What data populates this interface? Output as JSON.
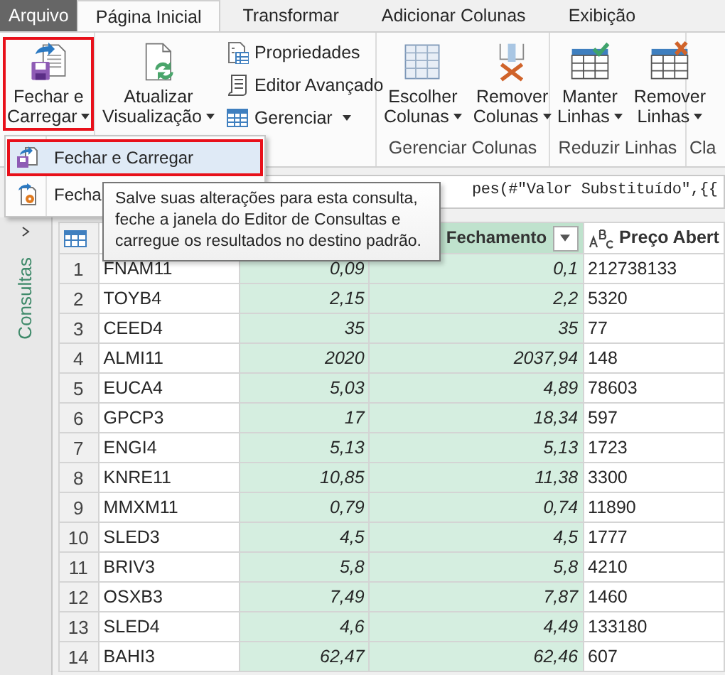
{
  "tabs": [
    {
      "label": "Arquivo",
      "kind": "file",
      "selected": false
    },
    {
      "label": "Página Inicial",
      "kind": "tab",
      "selected": true
    },
    {
      "label": "Transformar",
      "kind": "tab",
      "selected": false
    },
    {
      "label": "Adicionar Colunas",
      "kind": "tab",
      "selected": false
    },
    {
      "label": "Exibição",
      "kind": "tab",
      "selected": false
    }
  ],
  "ribbon": {
    "groups": [
      {
        "buttons": [
          {
            "kind": "large",
            "lines": [
              "Fechar e",
              "Carregar"
            ],
            "dropdown": true,
            "outlined": true
          }
        ]
      },
      {
        "buttons": [
          {
            "kind": "large",
            "lines": [
              "Atualizar",
              "Visualização"
            ],
            "dropdown": true,
            "outlined": false
          },
          {
            "kind": "small",
            "lines": [
              "Propriedades"
            ],
            "dropdown": false,
            "outlined": false
          },
          {
            "kind": "small",
            "lines": [
              "Editor Avançado"
            ],
            "dropdown": false,
            "outlined": false
          },
          {
            "kind": "small",
            "lines": [
              "Gerenciar"
            ],
            "dropdown": true,
            "outlined": false
          }
        ]
      },
      {
        "label": "Gerenciar Colunas",
        "buttons": [
          {
            "kind": "large",
            "lines": [
              "Escolher",
              "Colunas"
            ],
            "dropdown": true,
            "outlined": false
          },
          {
            "kind": "large",
            "lines": [
              "Remover",
              "Colunas"
            ],
            "dropdown": true,
            "outlined": false
          }
        ]
      },
      {
        "label": "Reduzir Linhas",
        "buttons": [
          {
            "kind": "large",
            "lines": [
              "Manter",
              "Linhas"
            ],
            "dropdown": true,
            "outlined": false
          },
          {
            "kind": "large",
            "lines": [
              "Remover",
              "Linhas"
            ],
            "dropdown": true,
            "outlined": false
          }
        ]
      },
      {
        "label": "Cla"
      }
    ]
  },
  "menu": {
    "items": [
      {
        "label": "Fechar e Carregar",
        "selected": true,
        "outlined": true
      },
      {
        "label": "Fecha",
        "selected": false,
        "outlined": false
      }
    ]
  },
  "tooltip": {
    "lines": [
      "Salve suas alterações para esta consulta,",
      "feche a janela do Editor de Consultas e",
      "carregue os resultados no destino padrão."
    ]
  },
  "formula_bar": {
    "value": "pes(#\"Valor Substituído\",{{"
  },
  "sidebar": {
    "label": "Consultas"
  },
  "table": {
    "columns": [
      {
        "selected": false
      },
      {
        "selected": true
      },
      {
        "label": "Fechamento",
        "selected": true,
        "kind": "filter"
      },
      {
        "label": "Preço Abert",
        "selected": false,
        "kind": "text"
      }
    ],
    "rows": [
      {
        "n": "1",
        "cells": [
          "FNAM11",
          "0,09",
          "0,1",
          "212738133"
        ]
      },
      {
        "n": "2",
        "cells": [
          "TOYB4",
          "2,15",
          "2,2",
          "5320"
        ]
      },
      {
        "n": "3",
        "cells": [
          "CEED4",
          "35",
          "35",
          "77"
        ]
      },
      {
        "n": "4",
        "cells": [
          "ALMI11",
          "2020",
          "2037,94",
          "148"
        ]
      },
      {
        "n": "5",
        "cells": [
          "EUCA4",
          "5,03",
          "4,89",
          "78603"
        ]
      },
      {
        "n": "6",
        "cells": [
          "GPCP3",
          "17",
          "18,34",
          "597"
        ]
      },
      {
        "n": "7",
        "cells": [
          "ENGI4",
          "5,13",
          "5,13",
          "1723"
        ]
      },
      {
        "n": "8",
        "cells": [
          "KNRE11",
          "10,85",
          "11,38",
          "3300"
        ]
      },
      {
        "n": "9",
        "cells": [
          "MMXM11",
          "0,79",
          "0,74",
          "11890"
        ]
      },
      {
        "n": "10",
        "cells": [
          "SLED3",
          "4,5",
          "4,5",
          "1777"
        ]
      },
      {
        "n": "11",
        "cells": [
          "BRIV3",
          "5,8",
          "5,8",
          "4210"
        ]
      },
      {
        "n": "12",
        "cells": [
          "OSXB3",
          "7,49",
          "7,87",
          "1460"
        ]
      },
      {
        "n": "13",
        "cells": [
          "SLED4",
          "4,6",
          "4,49",
          "133180"
        ]
      },
      {
        "n": "14",
        "cells": [
          "BAHI3",
          "62,47",
          "62,46",
          "607"
        ]
      }
    ]
  }
}
